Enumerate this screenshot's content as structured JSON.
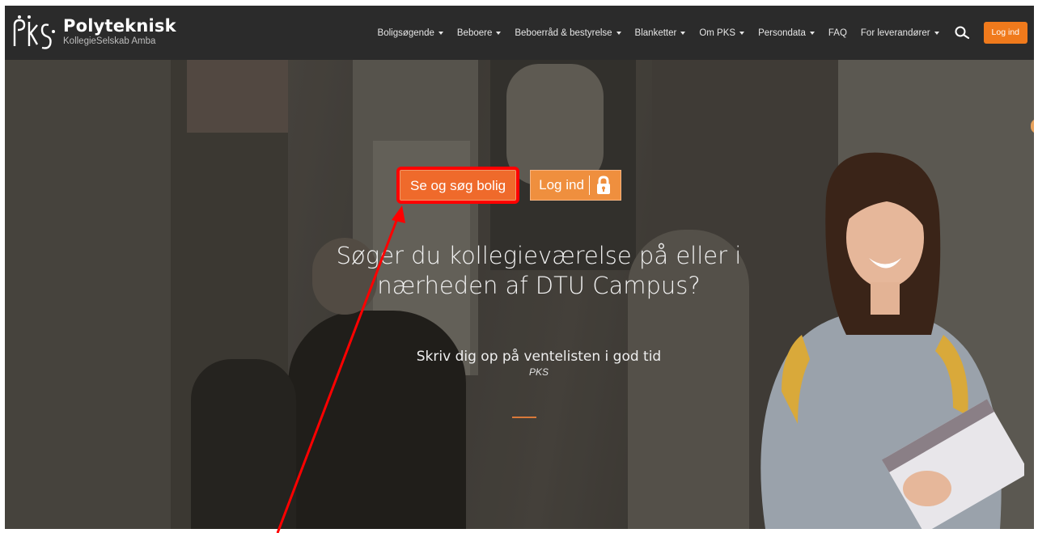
{
  "navbar": {
    "logo_title": "Polyteknisk",
    "logo_subtitle": "KollegieSelskab Amba",
    "items": [
      {
        "label": "Boligsøgende",
        "dropdown": true
      },
      {
        "label": "Beboere",
        "dropdown": true
      },
      {
        "label": "Beboerråd & bestyrelse",
        "dropdown": true
      },
      {
        "label": "Blanketter",
        "dropdown": true
      },
      {
        "label": "Om PKS",
        "dropdown": true
      },
      {
        "label": "Persondata",
        "dropdown": true
      },
      {
        "label": "FAQ",
        "dropdown": false
      },
      {
        "label": "For leverandører",
        "dropdown": true
      }
    ],
    "search_icon": "search-icon",
    "login_label": "Log ind"
  },
  "hero": {
    "primary_button": "Se og søg bolig",
    "secondary_button": "Log ind",
    "secondary_icon": "lock-icon",
    "headline": "Søger du kollegieværelse på eller i nærheden af DTU Campus?",
    "subline": "Skriv dig op på ventelisten i god tid",
    "sublabel": "PKS"
  },
  "colors": {
    "accent": "#f07a1c",
    "navbar_bg": "#2b2b2b",
    "annotation": "#ff0000"
  }
}
